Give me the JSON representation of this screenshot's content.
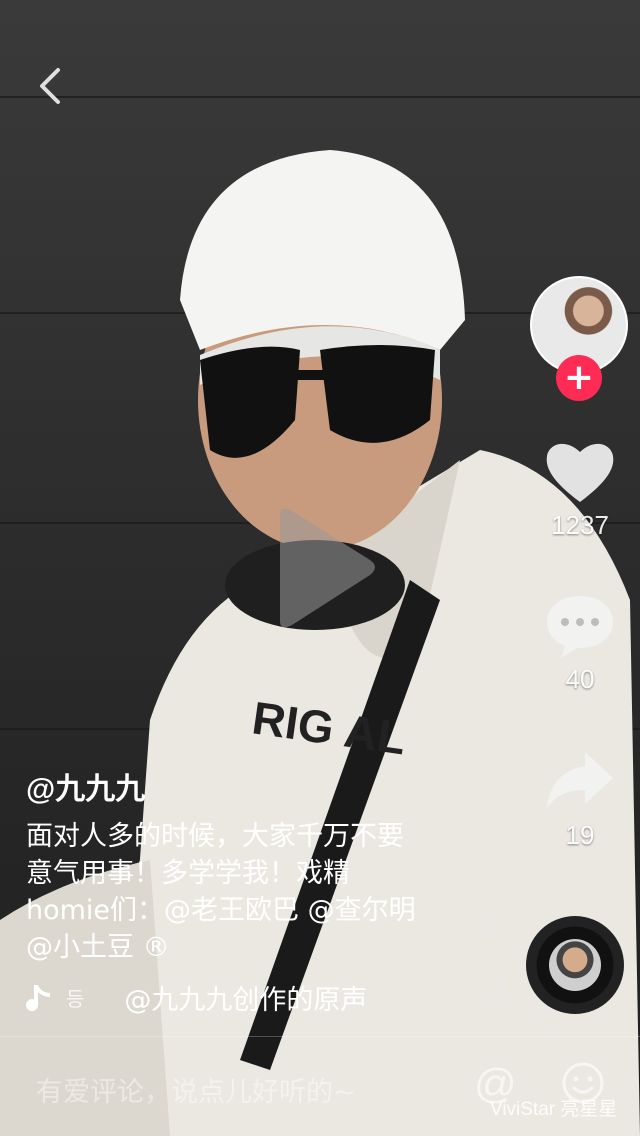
{
  "author": {
    "handle": "@九九九"
  },
  "caption": {
    "lines": [
      "面对人多的时候，大家千万不要",
      "意气用事！多学学我！戏精",
      "homie们：@老王欧巴 @查尔明",
      "@小土豆 ®"
    ]
  },
  "music": {
    "scroll_glyph": "등",
    "title": "@九九九创作的原声"
  },
  "stats": {
    "likes": "1237",
    "comments": "40",
    "shares": "19"
  },
  "comment_bar": {
    "placeholder": "有爱评论，说点儿好听的~"
  },
  "watermark": "ViviStar 亮星星",
  "icons": {
    "back": "back-icon",
    "play": "play-icon",
    "follow": "plus-icon",
    "like": "heart-icon",
    "comment": "comment-bubble-icon",
    "share": "share-arrow-icon",
    "music": "music-note-icon",
    "at": "at-icon",
    "emoji": "emoji-icon"
  },
  "colors": {
    "accent": "#fe2c55"
  }
}
